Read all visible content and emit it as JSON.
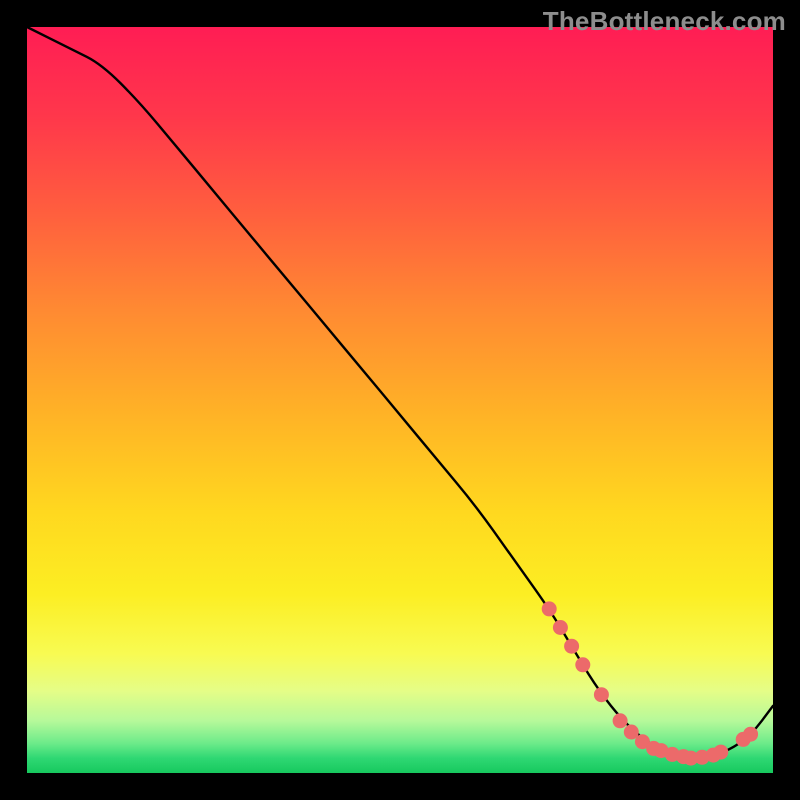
{
  "attribution": "TheBottleneck.com",
  "colors": {
    "page_bg": "#000000",
    "curve_stroke": "#000000",
    "marker_fill": "#ec6a6a",
    "marker_stroke": "#b93d3d",
    "attribution_text": "#8d8d8d"
  },
  "chart_data": {
    "type": "line",
    "title": "",
    "xlabel": "",
    "ylabel": "",
    "xlim": [
      0,
      100
    ],
    "ylim": [
      0,
      100
    ],
    "grid": false,
    "legend": false,
    "series": [
      {
        "name": "bottleneck-curve",
        "x": [
          0,
          6,
          10,
          15,
          20,
          25,
          30,
          35,
          40,
          45,
          50,
          55,
          60,
          65,
          70,
          73,
          76,
          79,
          82,
          85,
          88,
          91,
          94,
          97,
          100
        ],
        "y": [
          100,
          97,
          95,
          90,
          84,
          78,
          72,
          66,
          60,
          54,
          48,
          42,
          36,
          29,
          22,
          17,
          12,
          8,
          5,
          3,
          2,
          2,
          3,
          5,
          9
        ]
      }
    ],
    "markers": {
      "series": "bottleneck-curve",
      "points": [
        {
          "x": 70,
          "y": 22
        },
        {
          "x": 71.5,
          "y": 19.5
        },
        {
          "x": 73,
          "y": 17
        },
        {
          "x": 74.5,
          "y": 14.5
        },
        {
          "x": 77,
          "y": 10.5
        },
        {
          "x": 79.5,
          "y": 7
        },
        {
          "x": 81,
          "y": 5.5
        },
        {
          "x": 82.5,
          "y": 4.2
        },
        {
          "x": 84,
          "y": 3.3
        },
        {
          "x": 85,
          "y": 3
        },
        {
          "x": 86.5,
          "y": 2.5
        },
        {
          "x": 88,
          "y": 2.2
        },
        {
          "x": 89,
          "y": 2
        },
        {
          "x": 90.5,
          "y": 2.1
        },
        {
          "x": 92,
          "y": 2.4
        },
        {
          "x": 93,
          "y": 2.8
        },
        {
          "x": 96,
          "y": 4.5
        },
        {
          "x": 97,
          "y": 5.2
        }
      ]
    },
    "gradient_stops": [
      {
        "pos": 0.0,
        "color": "#ff1d54"
      },
      {
        "pos": 0.12,
        "color": "#ff374b"
      },
      {
        "pos": 0.25,
        "color": "#ff5f3e"
      },
      {
        "pos": 0.38,
        "color": "#ff8a32"
      },
      {
        "pos": 0.52,
        "color": "#ffb326"
      },
      {
        "pos": 0.65,
        "color": "#ffd81f"
      },
      {
        "pos": 0.76,
        "color": "#fcee23"
      },
      {
        "pos": 0.84,
        "color": "#f8fb52"
      },
      {
        "pos": 0.89,
        "color": "#e5fd87"
      },
      {
        "pos": 0.93,
        "color": "#b6f99a"
      },
      {
        "pos": 0.96,
        "color": "#6deb8a"
      },
      {
        "pos": 0.98,
        "color": "#2fd873"
      },
      {
        "pos": 1.0,
        "color": "#17c95e"
      }
    ]
  }
}
